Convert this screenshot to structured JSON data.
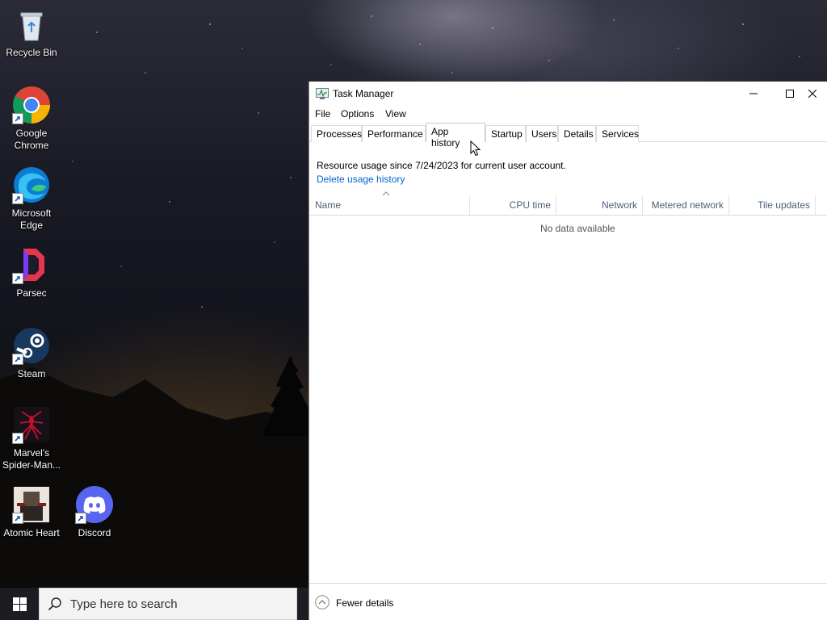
{
  "desktop": {
    "icons": [
      {
        "id": "recycle-bin",
        "label": "Recycle Bin"
      },
      {
        "id": "chrome",
        "label": "Google Chrome"
      },
      {
        "id": "edge",
        "label": "Microsoft Edge"
      },
      {
        "id": "parsec",
        "label": "Parsec"
      },
      {
        "id": "steam",
        "label": "Steam"
      },
      {
        "id": "spiderman",
        "label": "Marvel's Spider-Man..."
      },
      {
        "id": "atomic-heart",
        "label": "Atomic Heart"
      },
      {
        "id": "discord",
        "label": "Discord"
      }
    ]
  },
  "taskbar": {
    "search_placeholder": "Type here to search"
  },
  "task_manager": {
    "title": "Task Manager",
    "menu": [
      "File",
      "Options",
      "View"
    ],
    "tabs": [
      "Processes",
      "Performance",
      "App history",
      "Startup",
      "Users",
      "Details",
      "Services"
    ],
    "active_tab": "App history",
    "usage_text": "Resource usage since 7/24/2023 for current user account.",
    "delete_link": "Delete usage history",
    "columns": [
      "Name",
      "CPU time",
      "Network",
      "Metered network",
      "Tile updates"
    ],
    "empty_message": "No data available",
    "footer_label": "Fewer details"
  },
  "colors": {
    "link": "#0066cc",
    "column_header_text": "#4c607a",
    "taskbar": "#1b1d22"
  }
}
